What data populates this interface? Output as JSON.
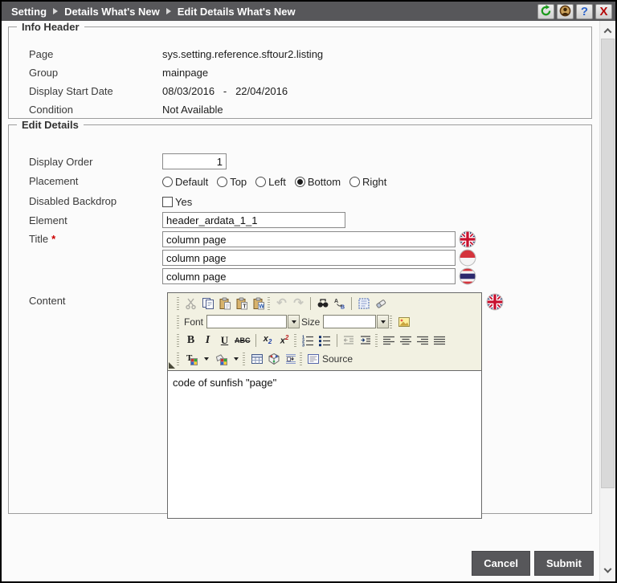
{
  "titlebar": {
    "breadcrumb": [
      "Setting",
      "Details What's New",
      "Edit Details What's New"
    ],
    "help_glyph": "?",
    "close_glyph": "X",
    "icons": [
      "refresh-icon",
      "support-icon",
      "help-icon",
      "close-icon"
    ]
  },
  "info_header": {
    "legend": "Info Header",
    "rows": [
      {
        "label": "Page",
        "value": "sys.setting.reference.sftour2.listing"
      },
      {
        "label": "Group",
        "value": "mainpage"
      },
      {
        "label": "Display Start Date",
        "value": "08/03/2016   -   22/04/2016"
      },
      {
        "label": "Condition",
        "value": "Not Available"
      }
    ]
  },
  "edit_details": {
    "legend": "Edit Details",
    "display_order": {
      "label": "Display Order",
      "value": "1"
    },
    "placement": {
      "label": "Placement",
      "options": [
        "Default",
        "Top",
        "Left",
        "Bottom",
        "Right"
      ],
      "selected": "Bottom"
    },
    "disabled_backdrop": {
      "label": "Disabled Backdrop",
      "option_label": "Yes",
      "checked": false
    },
    "element": {
      "label": "Element",
      "value": "header_ardata_1_1"
    },
    "title": {
      "label": "Title",
      "required_mark": "*",
      "values": [
        "column page",
        "column page",
        "column page"
      ],
      "languages": [
        "english",
        "indonesian",
        "thai"
      ]
    },
    "content": {
      "label": "Content",
      "language": "english",
      "text": "code of sunfish \"page\""
    }
  },
  "editor": {
    "font_label": "Font",
    "size_label": "Size",
    "bold": "B",
    "italic": "I",
    "underline": "U",
    "strike": "ABC",
    "sub_base": "x",
    "sub_mark": "2",
    "sup_base": "x",
    "sup_mark": "2",
    "undo_glyph": "↶",
    "redo_glyph": "↷",
    "source_label": "Source"
  },
  "footer": {
    "cancel_label": "Cancel",
    "submit_label": "Submit"
  },
  "colors": {
    "titlebar": "#57575a",
    "button": "#57575a",
    "accent_red": "#cc0000",
    "toolbar_bg": "#f2f1e2"
  }
}
